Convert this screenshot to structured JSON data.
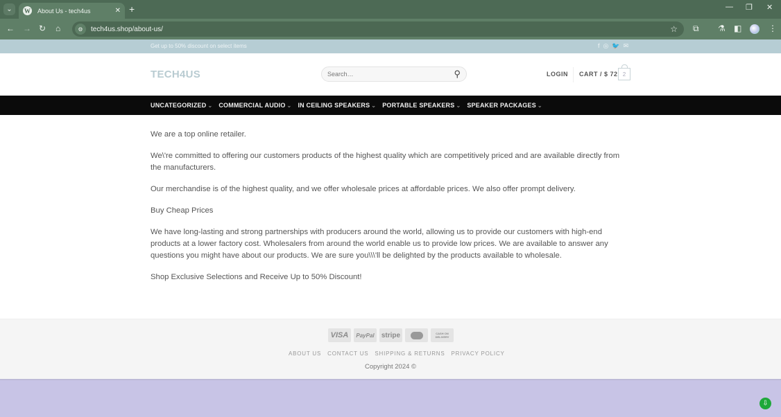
{
  "browser": {
    "tab_title": "About Us - tech4us",
    "tab_favicon": "W",
    "url": "tech4us.shop/about-us/",
    "icons": {
      "tab_list": "chevron-down",
      "close_tab": "✕",
      "new_tab": "+",
      "minimize": "—",
      "restore": "❐",
      "close_window": "✕",
      "back": "←",
      "forward": "→",
      "reload": "↻",
      "home": "⌂",
      "site_info": "⚙",
      "bookmark": "☆",
      "extensions": "⧉",
      "labs": "⚗",
      "sidebar": "◧",
      "menu": "⋮"
    }
  },
  "topbar": {
    "promo": "Get up to 50% discount on select items",
    "social": [
      "f",
      "◎",
      "🐦",
      "✉"
    ]
  },
  "header": {
    "logo": "TECH4US",
    "search_placeholder": "Search…",
    "search_icon": "⚲",
    "login": "LOGIN",
    "cart_label": "CART / $ 72",
    "cart_count": "2"
  },
  "nav": {
    "items": [
      {
        "label": "UNCATEGORIZED"
      },
      {
        "label": "COMMERCIAL AUDIO"
      },
      {
        "label": "IN CEILING SPEAKERS"
      },
      {
        "label": "PORTABLE SPEAKERS"
      },
      {
        "label": "SPEAKER PACKAGES"
      }
    ],
    "chevron": "⌄"
  },
  "content": {
    "paragraphs": [
      "We are a top online retailer.",
      "We\\'re committed to offering our customers products of the highest quality which are competitively priced and are available directly from the manufacturers.",
      "Our merchandise is of the highest quality, and we offer wholesale prices at affordable prices. We also offer prompt delivery.",
      "Buy Cheap Prices",
      "We have long-lasting and strong partnerships with producers around the world, allowing us to provide our customers with high-end products at a lower factory cost. Wholesalers from around the world enable us to provide low prices. We are available to answer any questions you might have about our products. We are sure you\\\\\\'ll be delighted by the products available to wholesale.",
      "Shop Exclusive Selections and Receive Up to 50% Discount!"
    ]
  },
  "footer": {
    "payments": [
      "VISA",
      "PayPal",
      "stripe",
      "MasterCard",
      "CASH ON DELIVERY"
    ],
    "links": [
      "ABOUT US",
      "CONTACT US",
      "SHIPPING & RETURNS",
      "PRIVACY POLICY"
    ],
    "copyright": "Copyright 2024 ©"
  },
  "floating_button_icon": "⇩"
}
